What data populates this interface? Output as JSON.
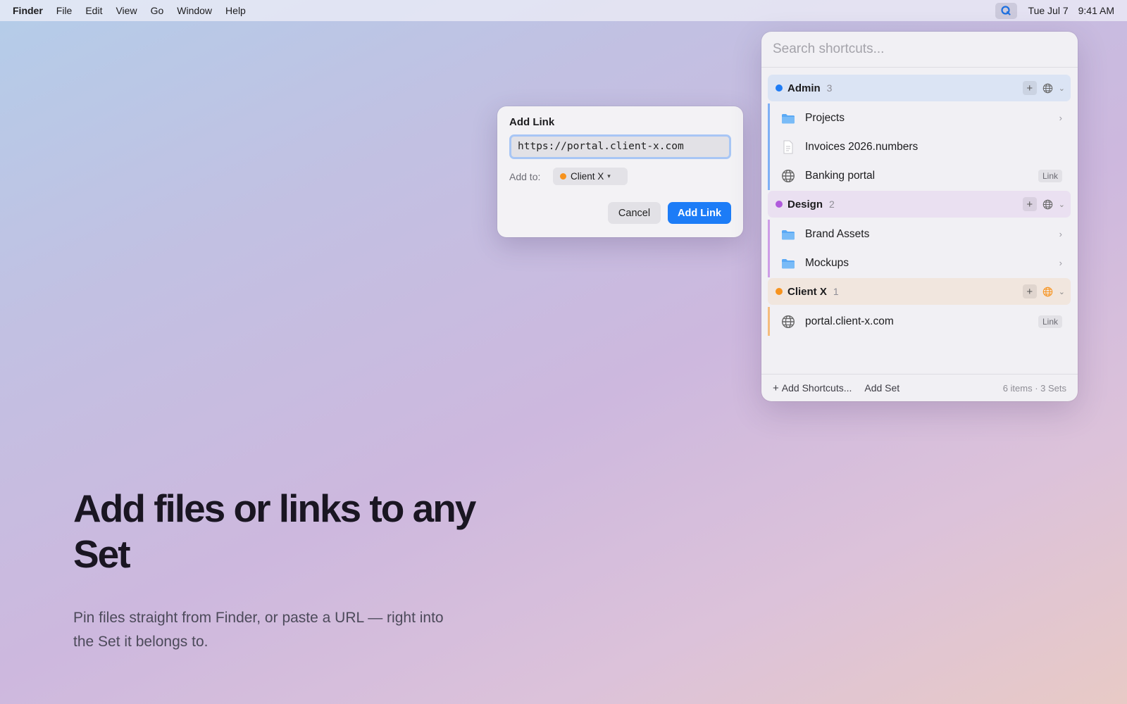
{
  "menubar": {
    "app_name": "Finder",
    "menus": [
      "File",
      "Edit",
      "View",
      "Go",
      "Window",
      "Help"
    ],
    "status_icon": "Q",
    "date": "Tue Jul 7",
    "time": "9:41 AM"
  },
  "hero": {
    "title": "Add files or links to any Set",
    "subtitle": "Pin files straight from Finder, or paste a URL — right into the Set it belongs to."
  },
  "dialog": {
    "title": "Add Link",
    "url_value": "https://portal.client-x.com",
    "add_to_label": "Add to:",
    "selected_set": "Client X",
    "selected_set_color": "#f7931e",
    "cancel_label": "Cancel",
    "confirm_label": "Add Link",
    "confirm_color": "#1c7cf7"
  },
  "panel": {
    "search_placeholder": "Search shortcuts...",
    "sets": [
      {
        "name": "Admin",
        "count": "3",
        "color": "#1f7cf5",
        "items": [
          {
            "label": "Projects",
            "icon": "folder-icon",
            "trail": "chevron"
          },
          {
            "label": "Invoices 2026.numbers",
            "icon": "document-icon",
            "trail": ""
          },
          {
            "label": "Banking portal",
            "icon": "globe-icon",
            "trail": "Link"
          }
        ]
      },
      {
        "name": "Design",
        "count": "2",
        "color": "#b05bdc",
        "items": [
          {
            "label": "Brand Assets",
            "icon": "folder-icon",
            "trail": "chevron"
          },
          {
            "label": "Mockups",
            "icon": "folder-icon",
            "trail": "chevron"
          }
        ]
      },
      {
        "name": "Client X",
        "count": "1",
        "color": "#f7931e",
        "items": [
          {
            "label": "portal.client-x.com",
            "icon": "globe-icon",
            "trail": "Link"
          }
        ]
      }
    ],
    "footer": {
      "add_shortcuts_label": "Add Shortcuts...",
      "add_set_label": "Add Set",
      "summary": "6 items · 3 Sets"
    }
  }
}
